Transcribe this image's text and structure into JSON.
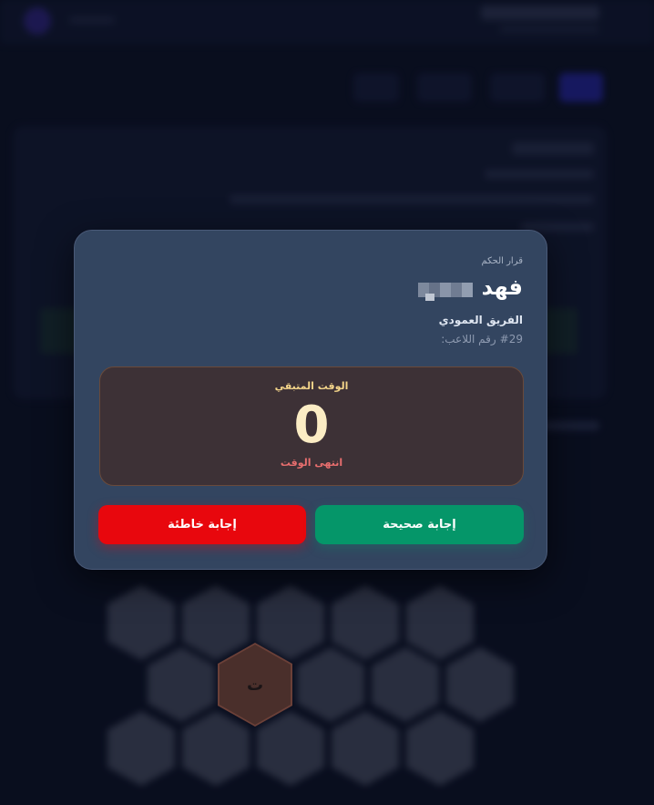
{
  "modal": {
    "decision_label": "قرار الحكم",
    "player_first_name": "فهد",
    "team_name": "الفريق العمودي",
    "player_number_label": "رقم اللاعب:",
    "player_number_value": "#29"
  },
  "timer": {
    "title": "الوقت المتبقي",
    "value": "0",
    "status": "انتهى الوقت"
  },
  "actions": {
    "correct_label": "إجابة صحيحة",
    "wrong_label": "إجابة خاطئة"
  },
  "board": {
    "active_letter": "ت"
  },
  "colors": {
    "correct": "#059669",
    "wrong": "#e8070d",
    "modal_bg": "#334560",
    "timer_title": "#f4d58a",
    "timer_status": "#e86e6e"
  },
  "icons": {
    "redacted_surname": "redacted-text"
  }
}
